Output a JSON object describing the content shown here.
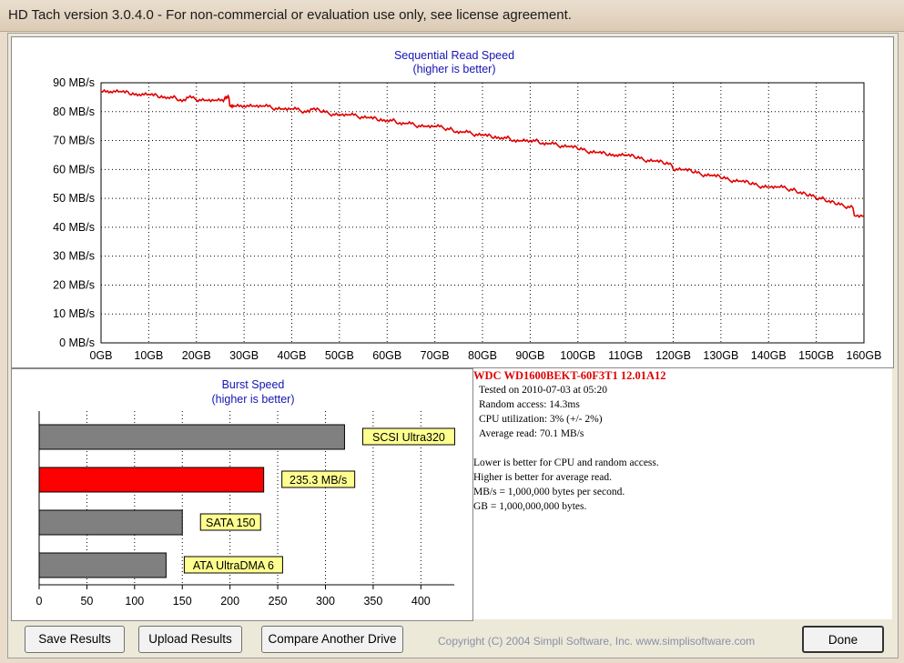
{
  "window": {
    "title": "HD Tach version 3.0.4.0  - For non-commercial or evaluation use only, see license agreement."
  },
  "seq_chart": {
    "title": "Sequential Read Speed",
    "subtitle": "(higher is better)",
    "y_tick_labels": [
      "90 MB/s",
      "80 MB/s",
      "70 MB/s",
      "60 MB/s",
      "50 MB/s",
      "40 MB/s",
      "30 MB/s",
      "20 MB/s",
      "10 MB/s",
      "0 MB/s"
    ],
    "x_tick_labels": [
      "0GB",
      "10GB",
      "20GB",
      "30GB",
      "40GB",
      "50GB",
      "60GB",
      "70GB",
      "80GB",
      "90GB",
      "100GB",
      "110GB",
      "120GB",
      "130GB",
      "140GB",
      "150GB",
      "160GB"
    ],
    "line_color": "#e00000"
  },
  "burst_chart": {
    "title": "Burst Speed",
    "subtitle": "(higher is better)",
    "x_tick_labels": [
      "0",
      "50",
      "100",
      "150",
      "200",
      "250",
      "300",
      "350",
      "400"
    ]
  },
  "info": {
    "drive": "WDC  WD1600BEKT-60F3T1  12.01A12",
    "tested": "Tested on 2010-07-03 at 05:20",
    "random_access": "Random access: 14.3ms",
    "cpu": "CPU utilization: 3% (+/- 2%)",
    "average": "Average read: 70.1 MB/s",
    "note1": "Lower is better for CPU and random access.",
    "note2": "Higher is better for average read.",
    "note3": "MB/s = 1,000,000 bytes per second.",
    "note4": "GB = 1,000,000,000 bytes."
  },
  "buttons": {
    "save": "Save Results",
    "upload": "Upload Results",
    "compare": "Compare Another Drive",
    "done": "Done"
  },
  "copyright": "Copyright (C) 2004 Simpli Software, Inc. www.simplisoftware.com",
  "chart_data": [
    {
      "type": "line",
      "title": "Sequential Read Speed",
      "subtitle": "(higher is better)",
      "xlabel": "",
      "ylabel": "",
      "xlim": [
        0,
        160
      ],
      "ylim": [
        0,
        90
      ],
      "grid": true,
      "series": [
        {
          "x": [
            0,
            2,
            4,
            6,
            8,
            10,
            12,
            14,
            16,
            18,
            20,
            22,
            24,
            26,
            27,
            28,
            30,
            32,
            34,
            36,
            38,
            40,
            42,
            44,
            46,
            48,
            50,
            52,
            54,
            56,
            58,
            60,
            62,
            64,
            66,
            68,
            70,
            72,
            74,
            76,
            78,
            80,
            82,
            84,
            86,
            88,
            90,
            92,
            94,
            96,
            98,
            100,
            102,
            104,
            106,
            108,
            110,
            112,
            114,
            116,
            118,
            120,
            122,
            124,
            126,
            128,
            130,
            132,
            134,
            136,
            138,
            140,
            142,
            144,
            146,
            148,
            150,
            152,
            154,
            156,
            158,
            160
          ],
          "y": [
            87,
            87,
            87,
            86,
            86,
            86,
            85,
            85,
            84,
            85,
            84,
            84,
            84,
            85,
            82,
            82,
            82,
            82,
            82,
            81,
            81,
            81,
            80,
            81,
            80,
            79,
            79,
            79,
            78,
            78,
            77,
            77,
            76,
            76,
            75,
            75,
            75,
            74,
            73,
            73,
            72,
            72,
            71,
            71,
            70,
            70,
            70,
            69,
            69,
            68,
            68,
            67,
            66,
            66,
            65,
            65,
            65,
            64,
            63,
            63,
            62,
            60,
            60,
            59,
            58,
            58,
            57,
            56,
            56,
            55,
            54,
            54,
            54,
            53,
            52,
            51,
            50,
            49,
            48,
            47,
            44,
            44
          ]
        }
      ]
    },
    {
      "type": "bar",
      "title": "Burst Speed",
      "subtitle": "(higher is better)",
      "xlim": [
        0,
        435
      ],
      "orientation": "horizontal",
      "categories": [
        "SCSI Ultra320",
        "235.3 MB/s",
        "SATA 150",
        "ATA UltraDMA 6"
      ],
      "values": [
        320,
        235.3,
        150,
        133
      ],
      "colors": [
        "#808080",
        "#ff0000",
        "#808080",
        "#808080"
      ]
    }
  ]
}
